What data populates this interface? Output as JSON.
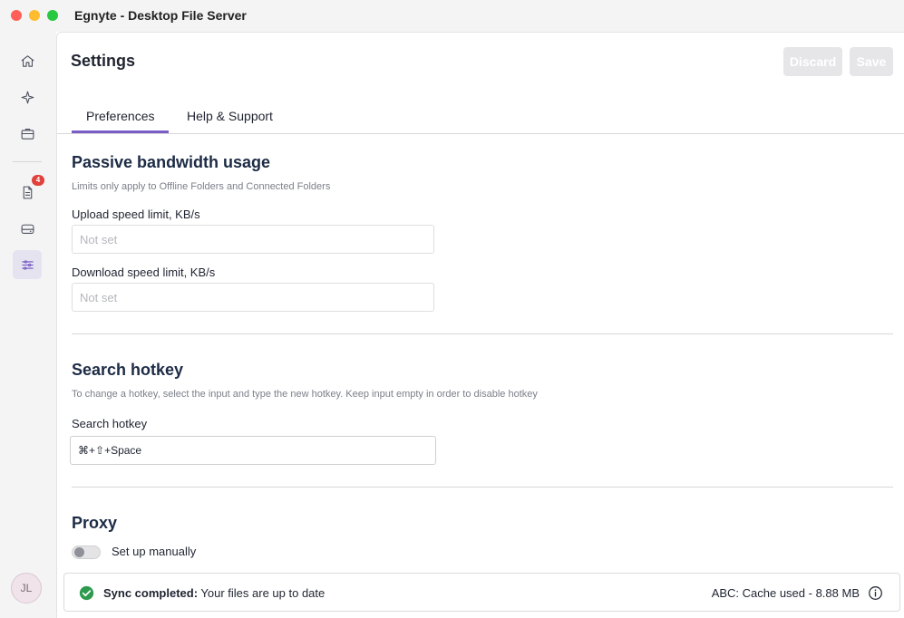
{
  "window": {
    "title": "Egnyte - Desktop File Server"
  },
  "sidebar": {
    "items": [
      {
        "name": "home",
        "icon": "home-icon"
      },
      {
        "name": "ai-assistant",
        "icon": "sparkle-icon"
      },
      {
        "name": "briefcase",
        "icon": "briefcase-icon"
      },
      {
        "name": "activity",
        "icon": "document-icon",
        "badge": "4"
      },
      {
        "name": "drive",
        "icon": "drive-icon"
      },
      {
        "name": "settings",
        "icon": "sliders-icon",
        "active": true
      }
    ],
    "avatar": "JL"
  },
  "header": {
    "title": "Settings",
    "discard_label": "Discard",
    "save_label": "Save"
  },
  "tabs": [
    {
      "label": "Preferences",
      "active": true
    },
    {
      "label": "Help & Support"
    }
  ],
  "bandwidth": {
    "title": "Passive bandwidth usage",
    "description": "Limits only apply to Offline Folders and Connected Folders",
    "upload_label": "Upload speed limit, KB/s",
    "upload_placeholder": "Not set",
    "download_label": "Download speed limit, KB/s",
    "download_placeholder": "Not set"
  },
  "hotkey": {
    "title": "Search hotkey",
    "description": "To change a hotkey, select the input and type the new hotkey. Keep input empty in order to disable hotkey",
    "label": "Search hotkey",
    "value": "⌘+⇧+Space"
  },
  "proxy": {
    "title": "Proxy",
    "toggle_label": "Set up manually",
    "toggle_on": false
  },
  "status": {
    "bold": "Sync completed:",
    "text": " Your files are up to date",
    "cache": "ABC: Cache used - 8.88 MB"
  },
  "colors": {
    "accent": "#7a5cc7",
    "success": "#2e9a4e",
    "badge": "#e0413b"
  }
}
